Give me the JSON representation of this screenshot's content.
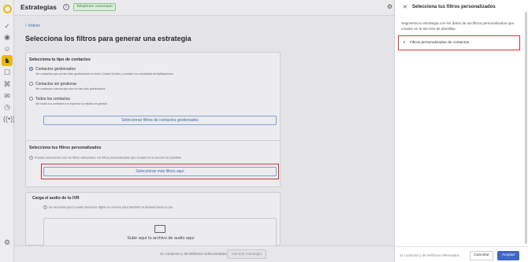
{
  "topbar": {
    "title": "Estrategias",
    "badge": "Telephone conectado"
  },
  "main": {
    "back": "Volver",
    "heading": "Selecciona los filtros para generar una estrategia",
    "contact_type": {
      "title": "Selecciona tu tipo de contactos",
      "options": [
        {
          "label": "Contactos gestionados",
          "desc": "Ver contactos que ya han sido gestionados en Aves Contact Center y cuentan con resultados de tipificaciones"
        },
        {
          "label": "Contactos sin gestionar",
          "desc": "Ver contactos nuevos que aún no han sido gestionados"
        },
        {
          "label": "Todos los contactos",
          "desc": "Ver todos los contactos sin importar su estado de gestión"
        }
      ],
      "button": "Seleccionar filtros de contactos gestionados"
    },
    "custom_filters": {
      "title": "Selecciona tus filtros personalizados",
      "warning": "Puedes seleccionar solo los filtros adicionales: los filtros personalizados que creaste en la sección de plantillas",
      "button": "Seleccionar más filtros aquí"
    },
    "audio": {
      "title": "Carga el audio de tu IVR",
      "warning": "Es necesario que tu audio mencione digitar un número para transferir la llamada hacia la cola",
      "upload": "Subir aquí tu archivo de audio aquí"
    },
    "footer": {
      "count": "41 contactos y 46 teléfonos seleccionados",
      "button": "Generar estrategia"
    }
  },
  "panel": {
    "title": "Selecciona tus filtros personalizados",
    "description": "Segmenta tu estrategia con los datos de tus filtros personalizados que creaste en la sección de plantillas.",
    "filter_label": "Filtros personalizados de contactos",
    "count": "41 contactos y 46 teléfonos interesados",
    "cancel": "Cancelar",
    "accept": "Aceptar"
  },
  "colors": {
    "accent": "#3f66c9",
    "highlight_border": "#d8342c",
    "brand_yellow": "#f2c200"
  }
}
